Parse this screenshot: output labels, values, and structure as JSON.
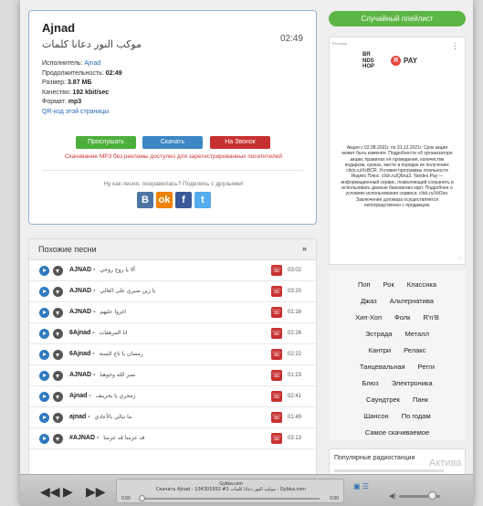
{
  "song": {
    "title": "Ajnad",
    "subtitle": "موكب النور دعانا كلمات",
    "time": "02:49",
    "info": {
      "artist_label": "Исполнитель:",
      "artist": "Ajnad",
      "duration_label": "Продолжительность:",
      "duration": "02:49",
      "size_label": "Размер:",
      "size": "3.87 МБ",
      "quality_label": "Качество:",
      "quality": "192 kbit/sec",
      "format_label": "Формат:",
      "format": "mp3",
      "qr_link": "QR-код этой страницы"
    },
    "buttons": {
      "listen": "Прослушать",
      "download": "Скачать",
      "ringtone": "На Звонок"
    },
    "note": "Скачивание MP3 без рекламы доступно для зарегистрированных посетителей",
    "share_text": "Ну как песня, понравилась? Поделись с друзьями!",
    "share_icons": [
      "vk-icon",
      "odnoklassniki-icon",
      "facebook-icon",
      "twitter-icon"
    ]
  },
  "random_playlist": "Случайный плейлист",
  "ad": {
    "label": "Реклама",
    "brand_lines": [
      "BR",
      "NDS",
      "HOP"
    ],
    "pay_label": "PAY",
    "text": "Акция с 02.08.2021г. по 31.12.2021г. Срок акции может быть изменён. Подробности об организаторе акции, правилах её проведения, количестве подарков, сроках, месте и порядке их получения: click.ru/XcBCR. Условия программы лояльности Яндекс Плюс: click.ru/Q6na3. Yandex.Pay — информационный сервис, позволяющий сохранять и использовать данные банковских карт. Подробнее о условиях использования сервиса: click.ru/Xd2so. Заключение договора осуществляется непосредственно с продавцом."
  },
  "genres": [
    [
      "Поп",
      "Рок",
      "Классика"
    ],
    [
      "Джаз",
      "Альтернатива"
    ],
    [
      "Хип-Хоп",
      "Фолк",
      "R'n'B"
    ],
    [
      "Эстрада",
      "Металл"
    ],
    [
      "Кантри",
      "Релакс"
    ],
    [
      "Танцевальная",
      "Регги"
    ],
    [
      "Блюз",
      "Электроника"
    ],
    [
      "Саундтрек",
      "Панк"
    ],
    [
      "Шансон",
      "По годам"
    ],
    [
      "Самое скачиваемое"
    ]
  ],
  "radio": {
    "title": "Популярные радиостанции"
  },
  "watermark": "Актива",
  "similar": {
    "title": "Похожие песни",
    "songs": [
      {
        "artist": "AJNAD",
        "title": "آلا يا روح روحي",
        "duration": "03:02"
      },
      {
        "artist": "AJNAD",
        "title": "يا زين صبري على العالي",
        "duration": "03:20"
      },
      {
        "artist": "AJNAD",
        "title": "اغزوا عليهم",
        "duration": "01:16"
      },
      {
        "artist": "6Ajnad",
        "title": "انا المرهفات",
        "duration": "02:26"
      },
      {
        "artist": "6Ajnad",
        "title": "رمضان يا تاج السنة",
        "duration": "02:22"
      },
      {
        "artist": "AJNAD",
        "title": "نصر الله وجوهنا",
        "duration": "01:23"
      },
      {
        "artist": "Ajnad",
        "title": "زمجري يا بحرينف",
        "duration": "02:41"
      },
      {
        "artist": "ajnad",
        "title": "ما تبالي بالأعادي",
        "duration": "01:49"
      },
      {
        "artist": "#AJNAD",
        "title": "قد عزمنا قد عزمنا",
        "duration": "03:13"
      }
    ]
  },
  "player": {
    "site": "Gybka.com",
    "now_playing": "Скачать Ajnad - 104301952 #1 موكب النور دعانا كلمات - Gybka.com",
    "time_start": "0:00",
    "time_end": "0:00",
    "volume": 0.8
  }
}
